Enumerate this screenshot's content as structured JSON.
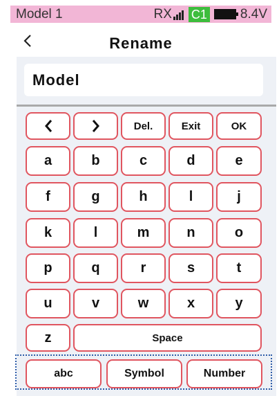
{
  "status": {
    "model": "Model 1",
    "rx_label": "RX",
    "channel": "C1",
    "voltage": "8.4V",
    "icons": [
      "signal-bars-icon",
      "battery-icon"
    ]
  },
  "header": {
    "back_icon": "chevron-left-icon",
    "title": "Rename"
  },
  "name_input": {
    "value": "Model"
  },
  "keyboard": {
    "nav": {
      "left_icon": "chevron-left-icon",
      "right_icon": "chevron-right-icon",
      "del": "Del.",
      "exit": "Exit",
      "ok": "OK"
    },
    "letters": [
      "a",
      "b",
      "c",
      "d",
      "e",
      "f",
      "g",
      "h",
      "l",
      "j",
      "k",
      "l",
      "m",
      "n",
      "o",
      "p",
      "q",
      "r",
      "s",
      "t",
      "u",
      "v",
      "w",
      "x",
      "y",
      "z"
    ],
    "space": "Space"
  },
  "modes": {
    "abc": "abc",
    "symbol": "Symbol",
    "number": "Number"
  },
  "colors": {
    "status_bg": "#f2b6d6",
    "channel_bg": "#3dbd3d",
    "key_border": "#e0555f",
    "panel_bg": "#eef1f6",
    "mode_border": "#2c5ba8"
  }
}
